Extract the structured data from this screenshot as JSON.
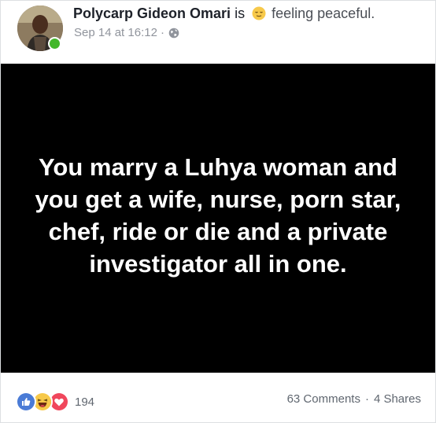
{
  "post": {
    "author": "Polycarp Gideon Omari",
    "is_text": "is",
    "feeling_icon": "relieved-face-emoji",
    "feeling": "feeling peaceful.",
    "timestamp": "Sep 14 at 16:12",
    "meta_separator": "·",
    "privacy_icon": "globe-icon",
    "image_text": "You marry a Luhya woman and you get a wife, nurse, porn star, chef, ride or die and a private investigator all in one."
  },
  "footer": {
    "reaction_icons": [
      "like-icon",
      "haha-icon",
      "love-icon"
    ],
    "reaction_count": "194",
    "comments": "63 Comments",
    "separator": "·",
    "shares": "4 Shares"
  },
  "colors": {
    "like_blue": "#4a7bd6",
    "haha_yellow": "#f7c94a",
    "love_red": "#f0475c",
    "online_green": "#42b72a"
  }
}
